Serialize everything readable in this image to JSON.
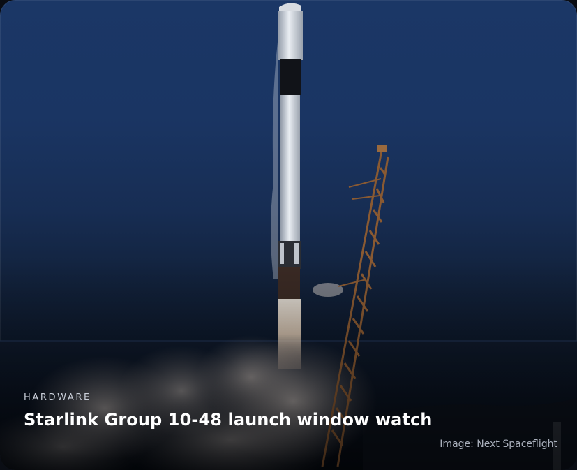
{
  "card": {
    "category": "HARDWARE",
    "title": "Starlink Group 10-48 launch window watch",
    "image_credit": "Image: Next Spaceflight"
  },
  "image": {
    "subject": "rocket launch with tilted launch tower and exhaust cloud",
    "sky_color": "#1b3766",
    "ground_color": "#070d17"
  }
}
